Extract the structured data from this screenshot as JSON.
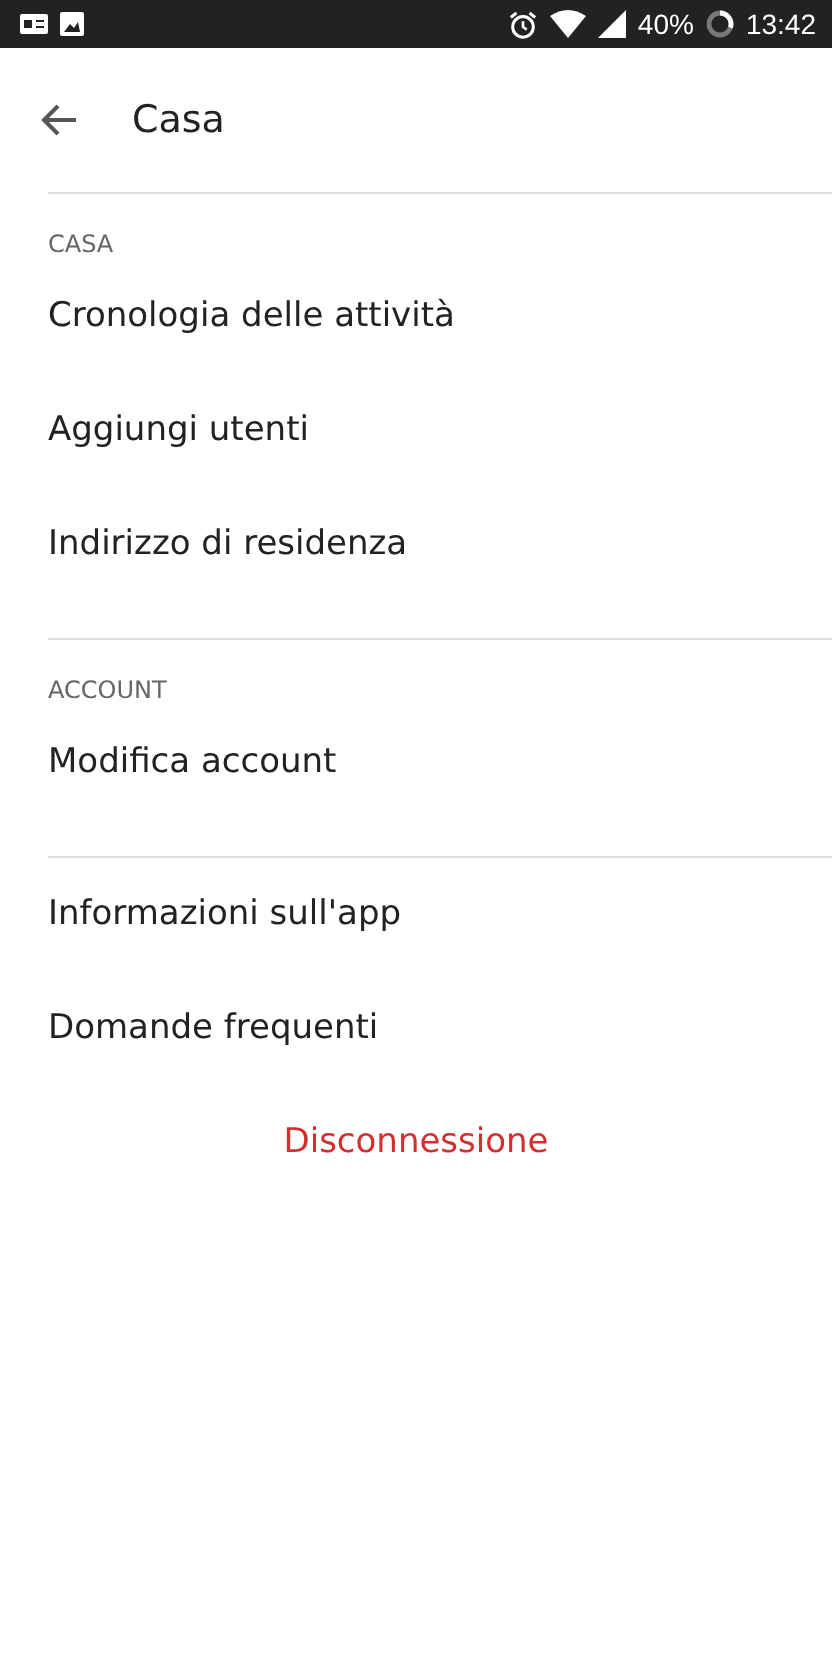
{
  "status_bar": {
    "battery": "40%",
    "time": "13:42"
  },
  "header": {
    "title": "Casa"
  },
  "sections": [
    {
      "header": "CASA",
      "items": [
        "Cronologia delle attività",
        "Aggiungi utenti",
        "Indirizzo di residenza"
      ]
    },
    {
      "header": "ACCOUNT",
      "items": [
        "Modifica account"
      ]
    },
    {
      "items": [
        "Informazioni sull'app",
        "Domande frequenti"
      ]
    }
  ],
  "logout": "Disconnessione"
}
